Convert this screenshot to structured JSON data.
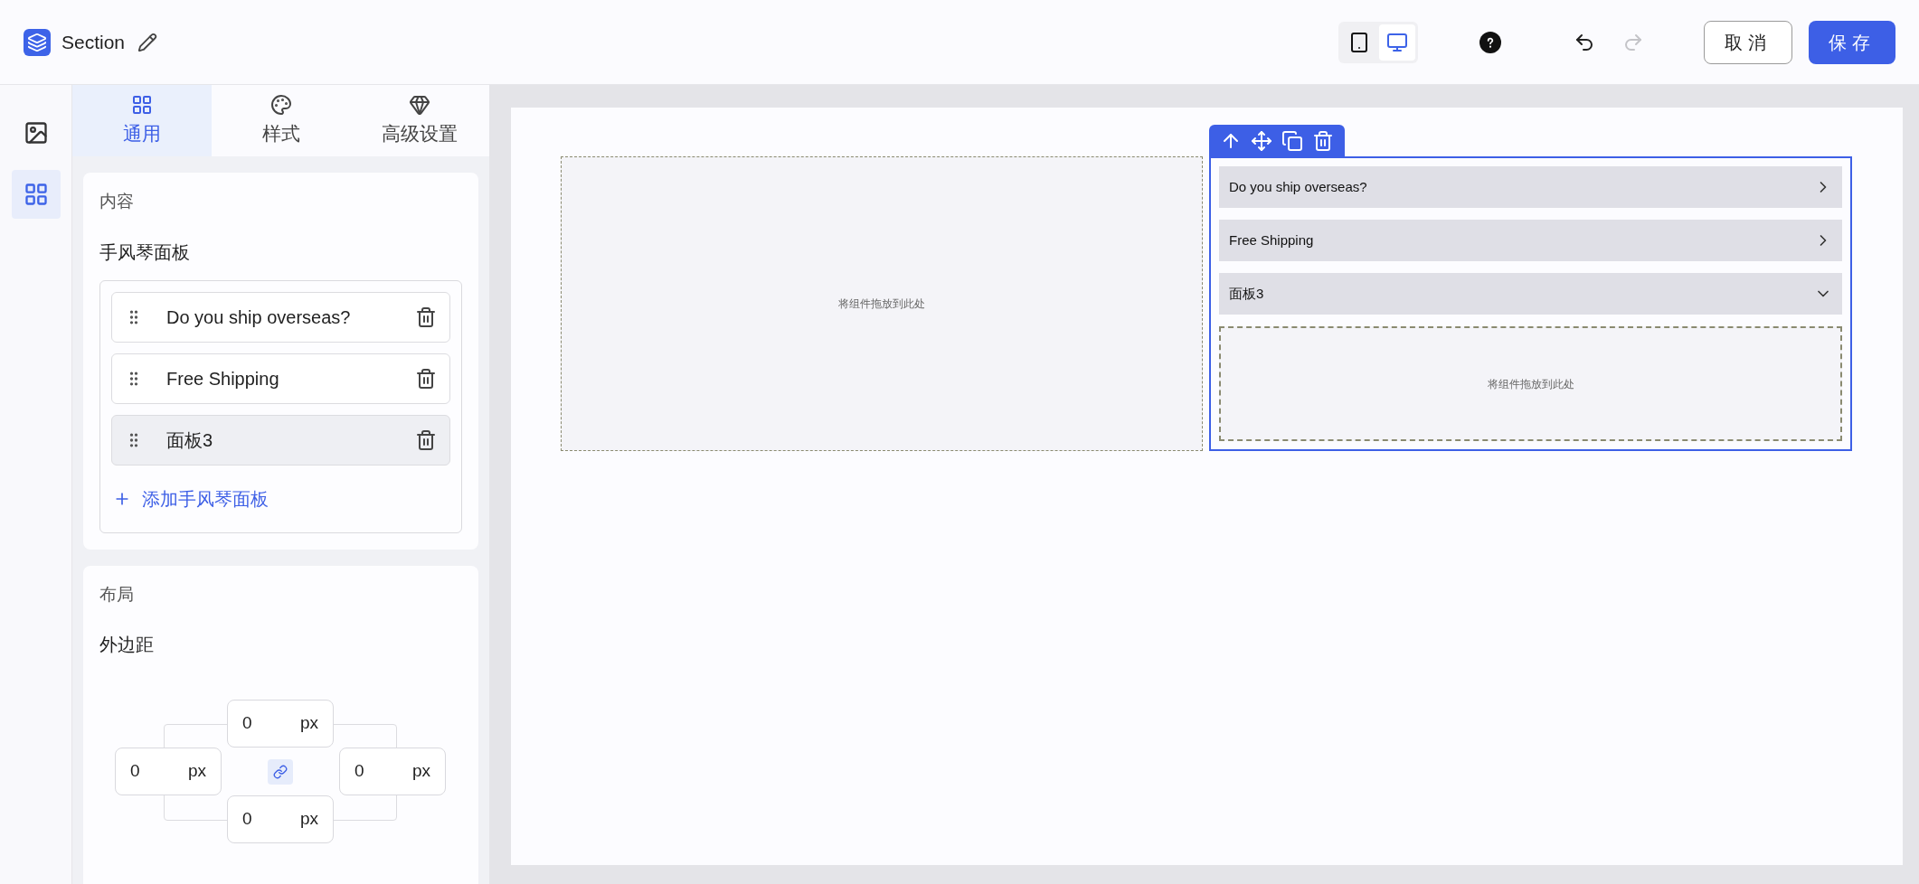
{
  "header": {
    "title": "Section",
    "devices": [
      {
        "kind": "tablet",
        "selected": false
      },
      {
        "kind": "desktop",
        "selected": true
      }
    ],
    "history": [
      {
        "kind": "undo",
        "disabled": false
      },
      {
        "kind": "redo",
        "disabled": true
      }
    ],
    "buttons": [
      {
        "label": "取消",
        "kind": "secondary"
      },
      {
        "label": "保存",
        "kind": "primary"
      }
    ]
  },
  "rail": [
    {
      "kind": "image",
      "selected": false
    },
    {
      "kind": "blocks",
      "selected": true
    }
  ],
  "tabs": [
    {
      "label": "通用",
      "kind": "grid",
      "selected": true
    },
    {
      "label": "样式",
      "kind": "palette",
      "selected": false
    },
    {
      "label": "高级设置",
      "kind": "gem",
      "selected": false
    }
  ],
  "content": {
    "title": "内容",
    "field_label": "手风琴面板",
    "panels": [
      {
        "label": "Do you ship overseas?",
        "selected": false
      },
      {
        "label": "Free Shipping",
        "selected": false
      },
      {
        "label": "面板3",
        "selected": true
      }
    ],
    "add_label": "添加手风琴面板"
  },
  "layout": {
    "title": "布局",
    "margin_label": "外边距",
    "margins": [
      {
        "value": "0",
        "unit": "px"
      },
      {
        "value": "0",
        "unit": "px"
      },
      {
        "value": "0",
        "unit": "px"
      },
      {
        "value": "0",
        "unit": "px"
      }
    ],
    "linked": true
  },
  "canvas": {
    "dropzone": "将组件拖放到此处",
    "toolbar": [
      {
        "kind": "up"
      },
      {
        "kind": "move"
      },
      {
        "kind": "copy"
      },
      {
        "kind": "delete"
      }
    ],
    "accordion": [
      {
        "label": "Do you ship overseas?",
        "expanded": false
      },
      {
        "label": "Free Shipping",
        "expanded": false
      },
      {
        "label": "面板3",
        "expanded": true
      }
    ],
    "inner_dropzone": "将组件拖放到此处"
  }
}
